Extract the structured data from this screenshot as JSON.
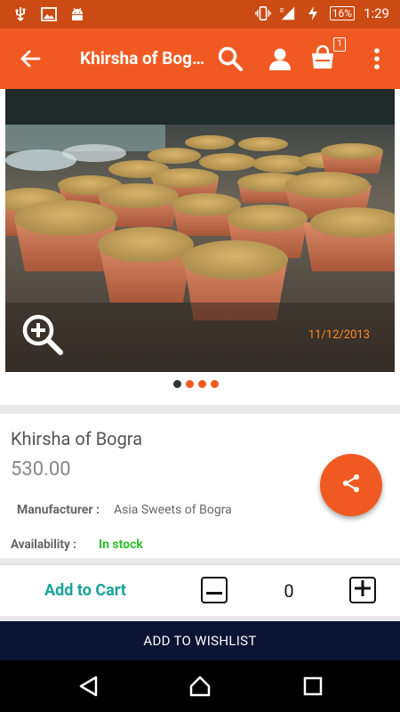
{
  "status_bar": {
    "battery": "16%",
    "time": "1:29"
  },
  "toolbar": {
    "title": "Khirsha of Bogra",
    "cart_count": "1",
    "icons": [
      "back-arrow-icon",
      "search-icon",
      "account-icon",
      "cart-icon",
      "more-vert-icon"
    ]
  },
  "gallery": {
    "photo_date": "11/12/2013",
    "dots": [
      true,
      false,
      false,
      false
    ]
  },
  "product": {
    "name": "Khirsha of Bogra",
    "price": "530.00",
    "manufacturer_label": "Manufacturer :",
    "manufacturer_value": "Asia Sweets of Bogra",
    "availability_label": "Availability :",
    "availability_value": "In stock"
  },
  "cart": {
    "add_label": "Add to Cart",
    "quantity": "0"
  },
  "wishlist": {
    "label": "ADD TO WISHLIST"
  },
  "colors": {
    "primary": "#f05a22",
    "primary_dark": "#cc4a14",
    "accent_text": "#1aa39a",
    "stock": "#2fbf2f",
    "wishlist_bg": "#0b1432"
  }
}
